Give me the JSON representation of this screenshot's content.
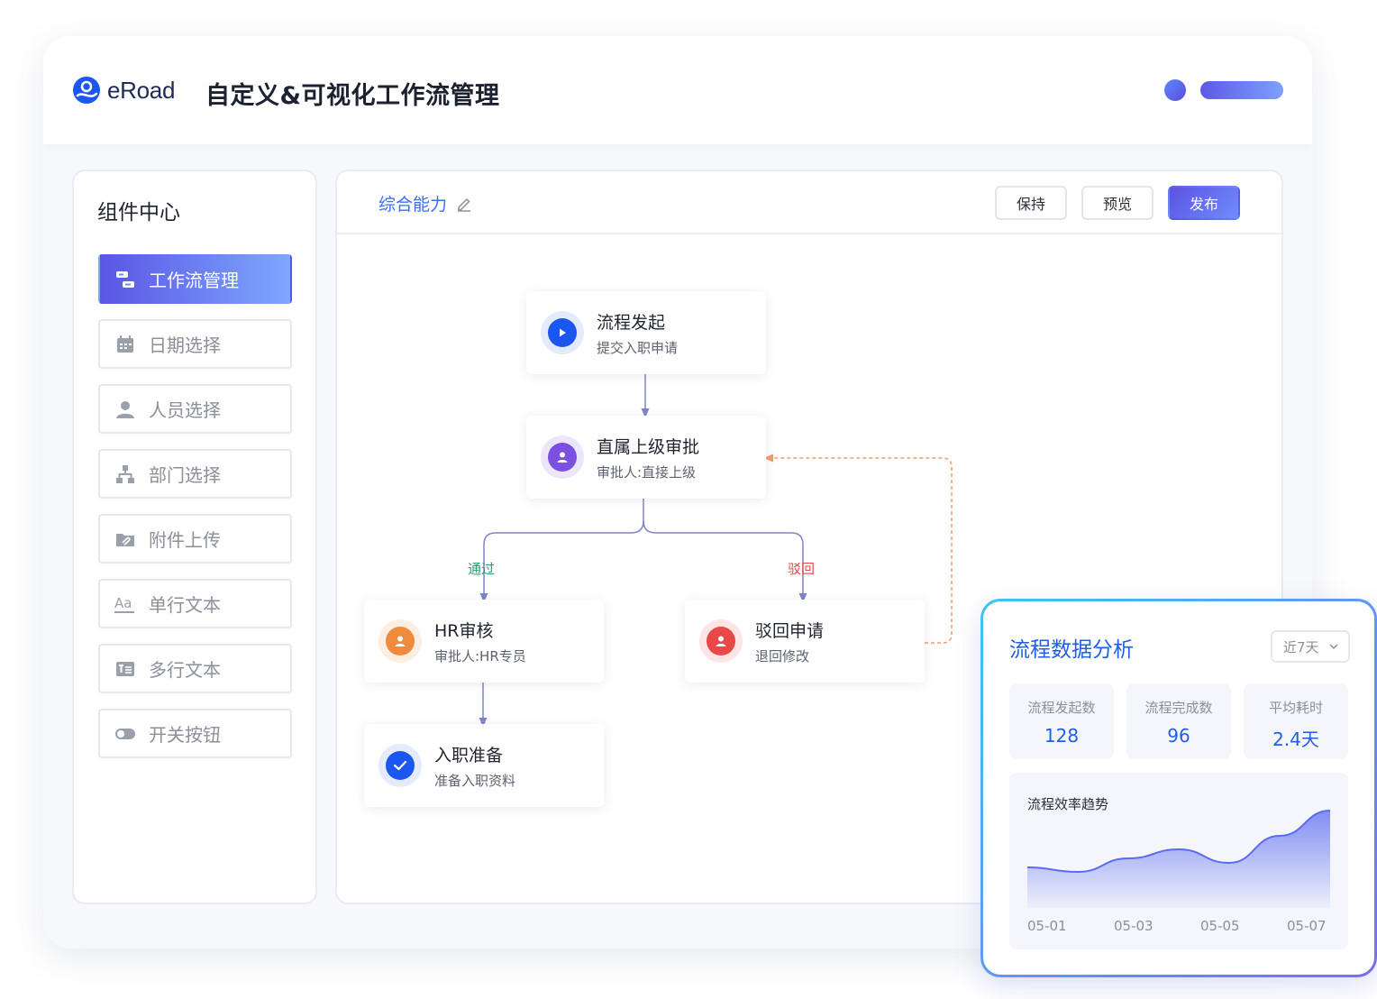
{
  "header": {
    "brand": "eRoad",
    "title": "自定义&可视化工作流管理"
  },
  "sidebar": {
    "title": "组件中心",
    "items": [
      {
        "label": "工作流管理",
        "icon": "workflow-icon",
        "active": true
      },
      {
        "label": "日期选择",
        "icon": "calendar-icon"
      },
      {
        "label": "人员选择",
        "icon": "user-icon"
      },
      {
        "label": "部门选择",
        "icon": "org-chart-icon"
      },
      {
        "label": "附件上传",
        "icon": "attachment-folder-icon"
      },
      {
        "label": "单行文本",
        "icon": "text-aa-icon"
      },
      {
        "label": "多行文本",
        "icon": "multiline-text-icon"
      },
      {
        "label": "开关按钮",
        "icon": "toggle-icon"
      }
    ]
  },
  "toolbar": {
    "breadcrumb": "综合能力",
    "save_label": "保持",
    "preview_label": "预览",
    "publish_label": "发布"
  },
  "flow": {
    "nodes": {
      "start": {
        "title": "流程发起",
        "sub": "提交入职申请",
        "icon": "play-icon",
        "color": "#1a56f0"
      },
      "manager": {
        "title": "直属上级审批",
        "sub": "审批人:直接上级",
        "icon": "person-icon",
        "color": "#7b4fe0"
      },
      "hr": {
        "title": "HR审核",
        "sub": "审批人:HR专员",
        "icon": "person-icon",
        "color": "#f08a3c"
      },
      "reject": {
        "title": "驳回申请",
        "sub": "退回修改",
        "icon": "person-icon",
        "color": "#e84848"
      },
      "onboard": {
        "title": "入职准备",
        "sub": "准备入职资料",
        "icon": "check-icon",
        "color": "#1a56f0"
      }
    },
    "edges": {
      "pass_label": "通过",
      "pass_color": "#2f9e6e",
      "reject_label": "驳回",
      "reject_color": "#e84848",
      "return_color": "#f59a6a"
    }
  },
  "analytics": {
    "title": "流程数据分析",
    "range": "近7天",
    "kpis": [
      {
        "label": "流程发起数",
        "value": "128"
      },
      {
        "label": "流程完成数",
        "value": "96"
      },
      {
        "label": "平均耗时",
        "value": "2.4天"
      }
    ],
    "trend_title": "流程效率趋势"
  },
  "chart_data": {
    "type": "area",
    "title": "流程效率趋势",
    "x": [
      "05-01",
      "05-02",
      "05-03",
      "05-04",
      "05-05",
      "05-06",
      "05-07"
    ],
    "x_tick_labels": [
      "05-01",
      "05-03",
      "05-05",
      "05-07"
    ],
    "series": [
      {
        "values": [
          35,
          30,
          45,
          55,
          40,
          70,
          98
        ]
      }
    ],
    "ylim": [
      0,
      100
    ],
    "color": "#5a6cf0",
    "grid": false
  }
}
